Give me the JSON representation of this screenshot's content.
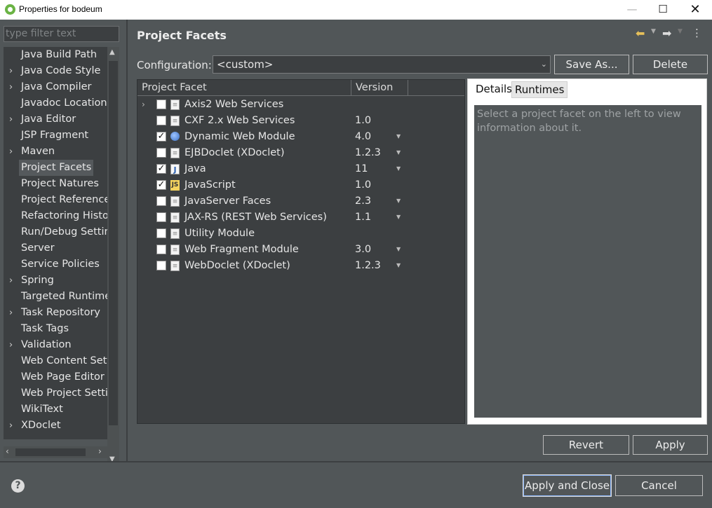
{
  "window": {
    "title": "Properties for bodeum",
    "min_glyph": "—",
    "max_glyph": "☐",
    "close_glyph": "✕"
  },
  "filter": {
    "placeholder": "type filter text"
  },
  "tree": {
    "items": [
      {
        "label": "Java Build Path",
        "expandable": false
      },
      {
        "label": "Java Code Style",
        "expandable": true
      },
      {
        "label": "Java Compiler",
        "expandable": true
      },
      {
        "label": "Javadoc Location",
        "expandable": false
      },
      {
        "label": "Java Editor",
        "expandable": true
      },
      {
        "label": "JSP Fragment",
        "expandable": false
      },
      {
        "label": "Maven",
        "expandable": true
      },
      {
        "label": "Project Facets",
        "expandable": false,
        "selected": true
      },
      {
        "label": "Project Natures",
        "expandable": false
      },
      {
        "label": "Project References",
        "expandable": false
      },
      {
        "label": "Refactoring Histor",
        "expandable": false
      },
      {
        "label": "Run/Debug Settin",
        "expandable": false
      },
      {
        "label": "Server",
        "expandable": false
      },
      {
        "label": "Service Policies",
        "expandable": false
      },
      {
        "label": "Spring",
        "expandable": true
      },
      {
        "label": "Targeted Runtime:",
        "expandable": false
      },
      {
        "label": "Task Repository",
        "expandable": true
      },
      {
        "label": "Task Tags",
        "expandable": false
      },
      {
        "label": "Validation",
        "expandable": true
      },
      {
        "label": "Web Content Setti",
        "expandable": false
      },
      {
        "label": "Web Page Editor",
        "expandable": false
      },
      {
        "label": "Web Project Settir",
        "expandable": false
      },
      {
        "label": "WikiText",
        "expandable": false
      },
      {
        "label": "XDoclet",
        "expandable": true
      }
    ]
  },
  "main": {
    "title": "Project Facets",
    "configuration_label": "Configuration:",
    "configuration_value": "<custom>",
    "save_as_label": "Save As...",
    "delete_label": "Delete",
    "columns": {
      "facet": "Project Facet",
      "version": "Version"
    },
    "facets": [
      {
        "name": "Axis2 Web Services",
        "version": "",
        "checked": false,
        "expandable": true,
        "icon": "document-icon",
        "has_dropdown": false
      },
      {
        "name": "CXF 2.x Web Services",
        "version": "1.0",
        "checked": false,
        "expandable": false,
        "icon": "document-icon",
        "has_dropdown": false
      },
      {
        "name": "Dynamic Web Module",
        "version": "4.0",
        "checked": true,
        "expandable": false,
        "icon": "web-module-icon",
        "has_dropdown": true
      },
      {
        "name": "EJBDoclet (XDoclet)",
        "version": "1.2.3",
        "checked": false,
        "expandable": false,
        "icon": "document-icon",
        "has_dropdown": true
      },
      {
        "name": "Java",
        "version": "11",
        "checked": true,
        "expandable": false,
        "icon": "java-icon",
        "has_dropdown": true
      },
      {
        "name": "JavaScript",
        "version": "1.0",
        "checked": true,
        "expandable": false,
        "icon": "javascript-icon",
        "has_dropdown": false
      },
      {
        "name": "JavaServer Faces",
        "version": "2.3",
        "checked": false,
        "expandable": false,
        "icon": "document-icon",
        "has_dropdown": true
      },
      {
        "name": "JAX-RS (REST Web Services)",
        "version": "1.1",
        "checked": false,
        "expandable": false,
        "icon": "document-icon",
        "has_dropdown": true
      },
      {
        "name": "Utility Module",
        "version": "",
        "checked": false,
        "expandable": false,
        "icon": "document-icon",
        "has_dropdown": false
      },
      {
        "name": "Web Fragment Module",
        "version": "3.0",
        "checked": false,
        "expandable": false,
        "icon": "document-icon",
        "has_dropdown": true
      },
      {
        "name": "WebDoclet (XDoclet)",
        "version": "1.2.3",
        "checked": false,
        "expandable": false,
        "icon": "document-icon",
        "has_dropdown": true
      }
    ],
    "details_tab": "Details",
    "runtimes_tab": "Runtimes",
    "details_text": "Select a project facet on the left to view information about it.",
    "revert_label": "Revert",
    "apply_label": "Apply"
  },
  "footer": {
    "apply_close_label": "Apply and Close",
    "cancel_label": "Cancel"
  },
  "colors": {
    "panel": "#515658",
    "field": "#3c3f41",
    "details_bg": "#ffffff",
    "checkbox": "#ffffff"
  }
}
